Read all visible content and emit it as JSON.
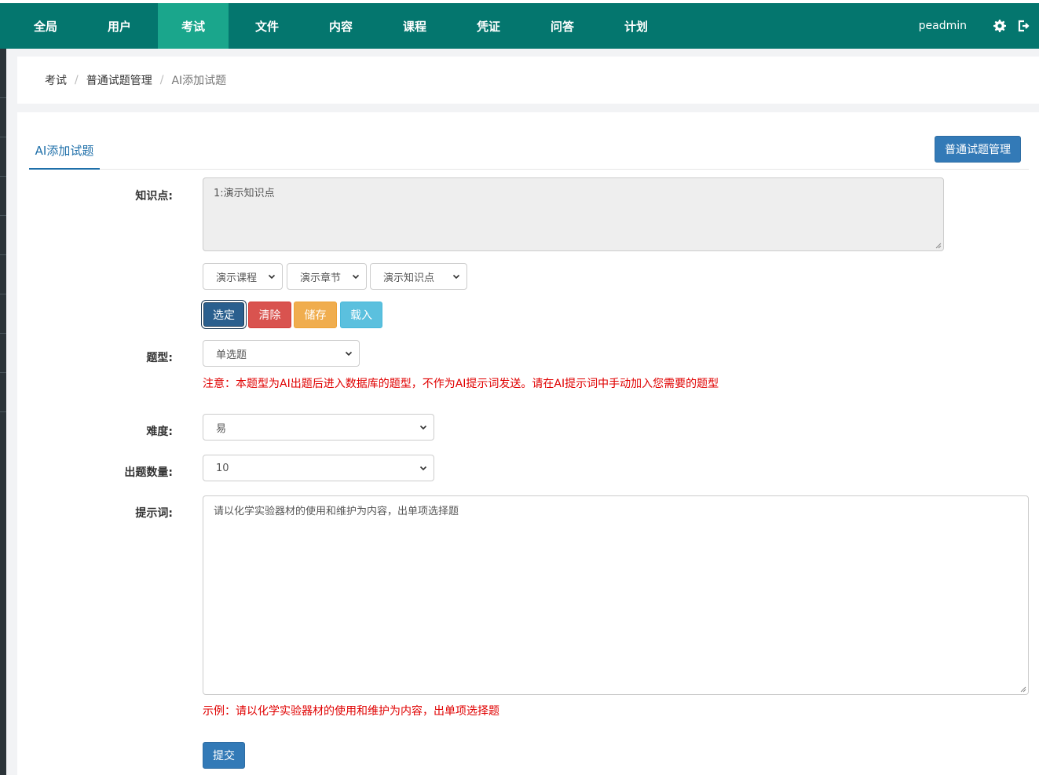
{
  "nav": {
    "items": [
      {
        "label": "全局",
        "active": false
      },
      {
        "label": "用户",
        "active": false
      },
      {
        "label": "考试",
        "active": true
      },
      {
        "label": "文件",
        "active": false
      },
      {
        "label": "内容",
        "active": false
      },
      {
        "label": "课程",
        "active": false
      },
      {
        "label": "凭证",
        "active": false
      },
      {
        "label": "问答",
        "active": false
      },
      {
        "label": "计划",
        "active": false
      }
    ],
    "user": "peadmin",
    "icons": [
      "gear-icon",
      "logout-icon"
    ],
    "colors": {
      "bar": "#04766e",
      "active": "#1aa68c"
    }
  },
  "breadcrumb": [
    "考试",
    "普通试题管理",
    "AI添加试题"
  ],
  "tab": {
    "active_label": "AI添加试题"
  },
  "manage_button": "普通试题管理",
  "form": {
    "knowledge": {
      "label": "知识点:",
      "value": "1:演示知识点",
      "course_select": "演示课程",
      "chapter_select": "演示章节",
      "point_select": "演示知识点",
      "buttons": {
        "select": "选定",
        "clear": "清除",
        "save": "储存",
        "load": "载入"
      }
    },
    "type": {
      "label": "题型:",
      "value": "单选题",
      "note": "注意：本题型为AI出题后进入数据库的题型，不作为AI提示词发送。请在AI提示词中手动加入您需要的题型"
    },
    "difficulty": {
      "label": "难度:",
      "value": "易"
    },
    "count": {
      "label": "出题数量:",
      "value": "10"
    },
    "prompt": {
      "label": "提示词:",
      "value": "请以化学实验器材的使用和维护为内容，出单项选择题",
      "example": "示例：请以化学实验器材的使用和维护为内容，出单项选择题"
    },
    "submit": "提交"
  }
}
